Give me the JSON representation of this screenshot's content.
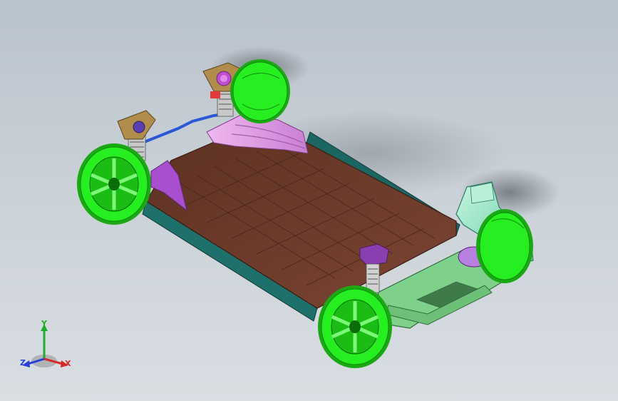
{
  "viewport": {
    "background_top": "#b9c3cc",
    "background_bottom": "#d9dee3"
  },
  "model": {
    "colors": {
      "tire": "#27ee20",
      "tire_dark": "#18b712",
      "battery_floor": "#6b3a2a",
      "battery_cell": "#7a4535",
      "frame_rail": "#1f6f6a",
      "subframe": "#7fd08a",
      "body_panel": "#e6a9e8",
      "purple_mount": "#a74fcf",
      "blue_bar": "#2a57d6",
      "duct": "#9be3c3"
    }
  },
  "triad": {
    "y_label": "Y",
    "z_label": "Z",
    "x_label": "X",
    "y_color": "#1fae2a",
    "z_color": "#2a3fd6",
    "x_color": "#d62a2a"
  }
}
